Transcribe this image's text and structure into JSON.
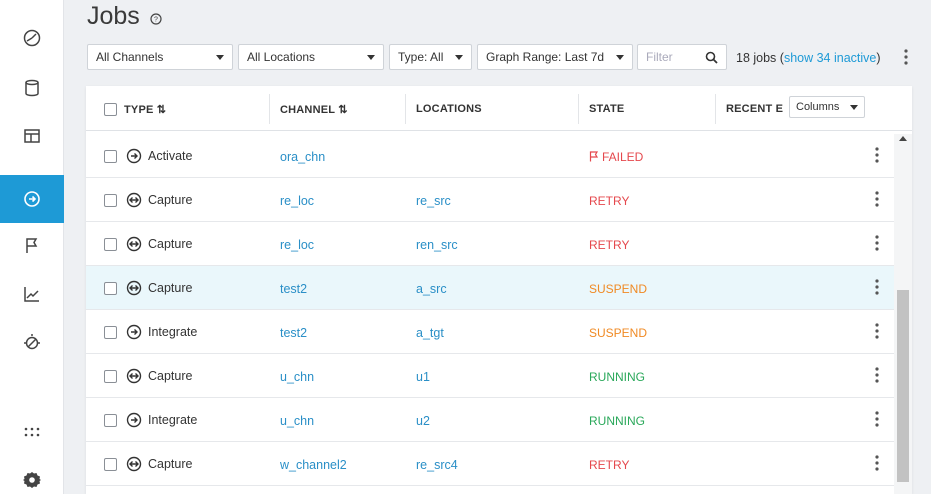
{
  "page": {
    "title": "Jobs"
  },
  "toolbar": {
    "channels": "All Channels",
    "locations": "All Locations",
    "type": "Type: All",
    "graph_range": "Graph Range: Last 7d",
    "filter_placeholder": "Filter",
    "jobs_count": "18 jobs (",
    "show_inactive": "show 34 inactive",
    "jobs_count_close": ")"
  },
  "table": {
    "headers": {
      "type": "TYPE",
      "channel": "CHANNEL",
      "locations": "LOCATIONS",
      "state": "STATE",
      "recent": "RECENT E",
      "columns": "Columns"
    },
    "sort_icon": "⇅",
    "rows": [
      {
        "type": "Activate",
        "icon": "activate-icon",
        "channel": "ora_chn",
        "location": "",
        "state": "FAILED",
        "state_color": "#e5484d",
        "flag": true
      },
      {
        "type": "Capture",
        "icon": "capture-icon",
        "channel": "re_loc",
        "location": "re_src",
        "state": "RETRY",
        "state_color": "#e5484d"
      },
      {
        "type": "Capture",
        "icon": "capture-icon",
        "channel": "re_loc",
        "location": "ren_src",
        "state": "RETRY",
        "state_color": "#e5484d"
      },
      {
        "type": "Capture",
        "icon": "capture-icon",
        "channel": "test2",
        "location": "a_src",
        "state": "SUSPEND",
        "state_color": "#f08a24",
        "highlight": true
      },
      {
        "type": "Integrate",
        "icon": "integrate-icon",
        "channel": "test2",
        "location": "a_tgt",
        "state": "SUSPEND",
        "state_color": "#f08a24"
      },
      {
        "type": "Capture",
        "icon": "capture-icon",
        "channel": "u_chn",
        "location": "u1",
        "state": "RUNNING",
        "state_color": "#2aa85a"
      },
      {
        "type": "Integrate",
        "icon": "integrate-icon",
        "channel": "u_chn",
        "location": "u2",
        "state": "RUNNING",
        "state_color": "#2aa85a"
      },
      {
        "type": "Capture",
        "icon": "capture-icon",
        "channel": "w_channel2",
        "location": "re_src4",
        "state": "RETRY",
        "state_color": "#e5484d"
      }
    ]
  },
  "colors": {
    "accent": "#1e9ad6",
    "link": "#2a8fc7"
  },
  "sidebar": [
    "dashboard-icon",
    "database-icon",
    "table-icon",
    "jobs-icon",
    "flag-icon",
    "chart-icon",
    "monitor-icon",
    "apps-grid-icon",
    "settings-gear-icon"
  ]
}
